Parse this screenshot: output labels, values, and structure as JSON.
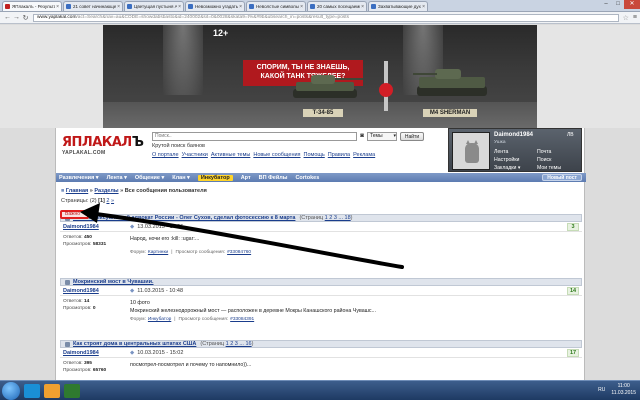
{
  "browser": {
    "tabs": [
      {
        "title": "ЯПлакалъ - Результаты п...",
        "active": true,
        "icon": "yaplakal-favicon"
      },
      {
        "title": "21 совет начинающему и...",
        "active": false,
        "icon": "page-favicon"
      },
      {
        "title": "Цветущая пустыня Анак...",
        "active": false,
        "icon": "page-favicon"
      },
      {
        "title": "Невозможно угадать...",
        "active": false,
        "icon": "page-favicon"
      },
      {
        "title": "Неволстые символы сов...",
        "active": false,
        "icon": "page-favicon"
      },
      {
        "title": "20 самых посещаемых ...",
        "active": false,
        "icon": "page-favicon"
      },
      {
        "title": "Захватывающие дух ма...",
        "active": false,
        "icon": "page-favicon"
      }
    ],
    "url_host": "www.yaplakal.com",
    "url_rest": "/act=Search&nav=au&CODE=showdabsbasto&id=240002&sit=0&0028&skata9=t%&#9b&ubsearch_in=posts&result_type=posts",
    "window_controls": [
      "–",
      "□",
      "✕"
    ]
  },
  "banner": {
    "age": "12+",
    "slogan_line1": "СПОРИМ, ТЫ НЕ ЗНАЕШЬ,",
    "slogan_line2": "КАКОЙ ТАНК ТЯЖЕЛЕЕ?",
    "tank_left": "T-34-85",
    "tank_right": "M4 SHERMAN"
  },
  "site": {
    "logo_name_red": "ЯПЛАКАЛ",
    "logo_name_black": "Ъ",
    "logo_sub": "YAPLAKAL.COM",
    "search_placeholder": "Поиск..",
    "search_scope": "Темы",
    "search_button": "Найти",
    "tagline": "Крутой поиск баянов",
    "top_links": [
      "О портале",
      "Участники",
      "Активные темы",
      "Новые сообщения",
      "Помощь",
      "Правила",
      "Реклама"
    ]
  },
  "user": {
    "name": "Daimond1984",
    "rank": "Ушка",
    "badge": "ЛВ",
    "menu": [
      "Лента",
      "Почта",
      "Настройки",
      "Поиск",
      "Закладки ▾",
      "Мои темы"
    ]
  },
  "menubar": {
    "items": [
      "Развлечения ▾",
      "Лента ▾",
      "Общение ▾",
      "Клан ▾",
      "Инкубатор",
      "Арт",
      "ВП Фейлы",
      "Cortokes"
    ],
    "highlight_index": 4,
    "new_post": "Новый пост"
  },
  "breadcrumb": {
    "home": "Главная",
    "sections": "Разделы",
    "current": "Все сообщения пользователя"
  },
  "pager": {
    "label": "Страницы:",
    "total": "(2)",
    "current": "[1]",
    "next": "2",
    "more": "»"
  },
  "marker_text": "Важно",
  "topics": [
    {
      "title": "Самый сексуальный адвокат России - Олег Сухов, сделал фотосессию к 8 марта",
      "pages_prefix": "(Страниц",
      "pages_links": "1 2 3 ... 18",
      "pages_suffix": ")",
      "author": "Daimond1984",
      "date": "13.03.2015 - 10:55",
      "count": "3",
      "answers_label": "Ответов:",
      "answers": "450",
      "views_label": "Просмотров:",
      "views": "58331",
      "text": "Народ, ночи его :kill: :ugar:...",
      "forum_label": "Форум:",
      "forum": "Картинки",
      "post_label": "Просмотр сообщения:",
      "post": "#33084760"
    },
    {
      "title": "Мокринский мост в Чувашии.",
      "pages_prefix": "",
      "pages_links": "",
      "pages_suffix": "",
      "author": "Daimond1984",
      "date": "11.03.2015 - 10:48",
      "count": "14",
      "answers_label": "Ответов:",
      "answers": "14",
      "views_label": "Просмотров:",
      "views": "0",
      "text": "10 фото",
      "text2": "Мокринский железнодорожный мост — расположен в деревне Мокры Канашского района Чувашс...",
      "forum_label": "Форум:",
      "forum": "Инкубатор",
      "post_label": "Просмотр сообщения:",
      "post": "#33084391"
    },
    {
      "title": "Как строят дома в центральных штатах США",
      "pages_prefix": "(Страниц",
      "pages_links": "1 2 3 ... 16",
      "pages_suffix": ")",
      "author": "Daimond1984",
      "date": "10.03.2015 - 15:02",
      "count": "17",
      "answers_label": "Ответов:",
      "answers": "395",
      "views_label": "Просмотров:",
      "views": "65760",
      "text": "посмотрел-посмотрел и почему то напомнило))...",
      "forum_label": "",
      "forum": "",
      "post_label": "",
      "post": ""
    }
  ],
  "taskbar": {
    "lang": "RU",
    "time": "11:00",
    "date": "11.03.2015"
  },
  "colors": {
    "accent": "#1a3d8c",
    "menubar": "#6a87bb",
    "highlight": "#ffd42a",
    "logo_red": "#c01818",
    "marker_red": "#e01f1f"
  }
}
